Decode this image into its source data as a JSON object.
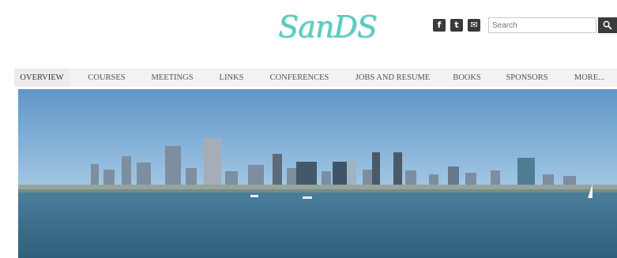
{
  "header": {
    "logo_text": "SanDS",
    "social": {
      "facebook": "f",
      "twitter": "t",
      "email": "✉"
    },
    "search": {
      "placeholder": "Search"
    }
  },
  "nav": {
    "items": [
      {
        "label": "OVERVIEW",
        "active": true
      },
      {
        "label": "COURSES"
      },
      {
        "label": "MEETINGS"
      },
      {
        "label": "LINKS"
      },
      {
        "label": "CONFERENCES"
      },
      {
        "label": "JOBS AND RESUME"
      },
      {
        "label": "BOOKS"
      },
      {
        "label": "SPONSORS"
      },
      {
        "label": "MORE..."
      }
    ]
  },
  "banner": {
    "image": "san-diego-skyline-panorama",
    "colors": {
      "sky": "#7fb0d8",
      "water": "#3c6f8d"
    }
  }
}
